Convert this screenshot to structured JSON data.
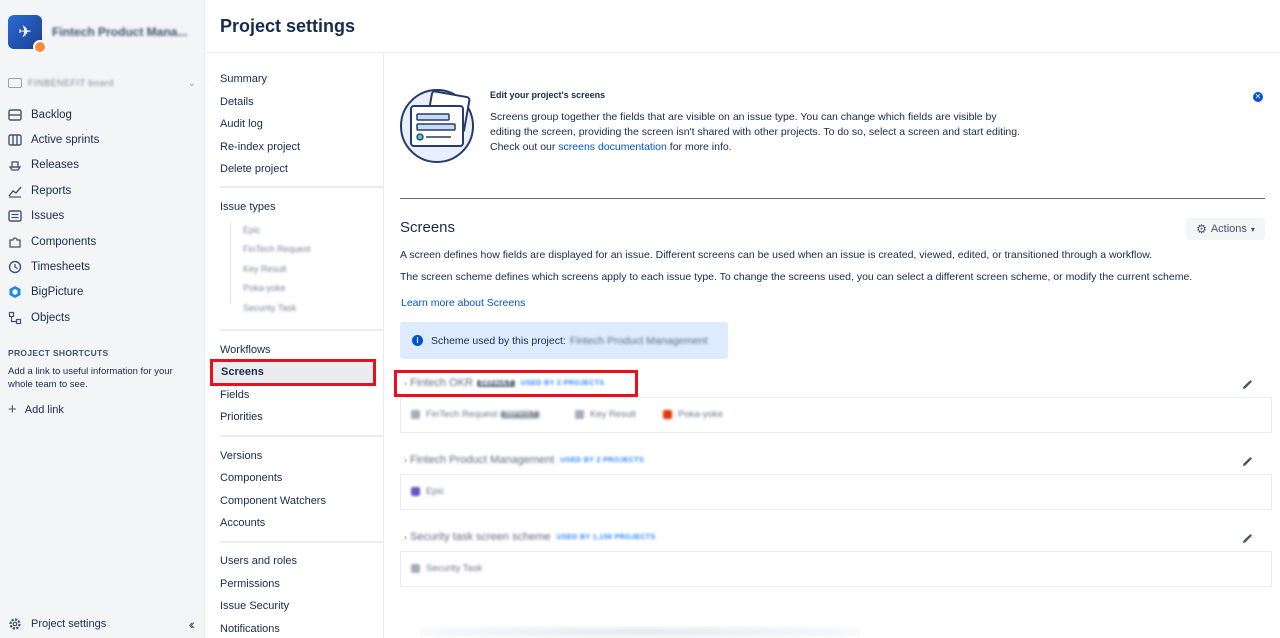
{
  "project": {
    "name": "Fintech Product Mana...",
    "board": "FINBENEFIT board"
  },
  "sidebar": {
    "items": [
      {
        "label": "Backlog",
        "icon": "backlog-icon"
      },
      {
        "label": "Active sprints",
        "icon": "board-icon"
      },
      {
        "label": "Releases",
        "icon": "ship-icon"
      },
      {
        "label": "Reports",
        "icon": "chart-icon"
      },
      {
        "label": "Issues",
        "icon": "issues-icon"
      },
      {
        "label": "Components",
        "icon": "puzzle-icon"
      },
      {
        "label": "Timesheets",
        "icon": "clock-icon"
      },
      {
        "label": "BigPicture",
        "icon": "bigpicture-icon"
      },
      {
        "label": "Objects",
        "icon": "objects-icon"
      }
    ],
    "shortcuts_title": "PROJECT SHORTCUTS",
    "shortcuts_text": "Add a link to useful information for your whole team to see.",
    "add_link": "Add link",
    "footer": "Project settings"
  },
  "header": {
    "title": "Project settings"
  },
  "settings_nav": {
    "group1": [
      "Summary",
      "Details",
      "Audit log",
      "Re-index project",
      "Delete project"
    ],
    "issue_types_label": "Issue types",
    "issue_types": [
      "Epic",
      "FinTech Request",
      "Key Result",
      "Poka-yoke",
      "Security Task"
    ],
    "group3": [
      "Workflows",
      "Screens",
      "Fields",
      "Priorities"
    ],
    "group4": [
      "Versions",
      "Components",
      "Component Watchers",
      "Accounts"
    ],
    "group5": [
      "Users and roles",
      "Permissions",
      "Issue Security",
      "Notifications"
    ]
  },
  "info": {
    "title": "Edit your project's screens",
    "line1": "Screens group together the fields that are visible on an issue type. You can change which fields are visible by",
    "line2": "editing the screen, providing the screen isn't shared with other projects. To do so, select a screen and start editing.",
    "line3_pre": "Check out our",
    "line3_link": "screens documentation",
    "line3_post": "for more info."
  },
  "screens": {
    "title": "Screens",
    "actions": "Actions",
    "para1": "A screen defines how fields are displayed for an issue. Different screens can be used when an issue is created, viewed, edited, or transitioned through a workflow.",
    "para2": "The screen scheme defines which screens apply to each issue type. To change the screens used, you can select a different screen scheme, or modify the current scheme.",
    "learn_more": "Learn more about Screens",
    "scheme_label": "Scheme used by this project:",
    "scheme_name": "Fintech Product Management"
  },
  "schemes": [
    {
      "name": "Fintech OKR",
      "badge": "DEFAULT",
      "used_by": "USED BY 2 PROJECTS",
      "issue_types": [
        "FinTech Request",
        "Key Result",
        "Poka-yoke"
      ],
      "issue_badge": "DEFAULT"
    },
    {
      "name": "Fintech Product Management",
      "used_by": "USED BY 2 PROJECTS",
      "issue_types": [
        "Epic"
      ]
    },
    {
      "name": "Security task screen scheme",
      "used_by": "USED BY 1,158 PROJECTS",
      "issue_types": [
        "Security Task"
      ]
    }
  ],
  "colors": {
    "brand": "#0052cc",
    "highlight": "#e8101e",
    "sidebar_bg": "#f4f5f7",
    "info_bg": "#deebff"
  }
}
